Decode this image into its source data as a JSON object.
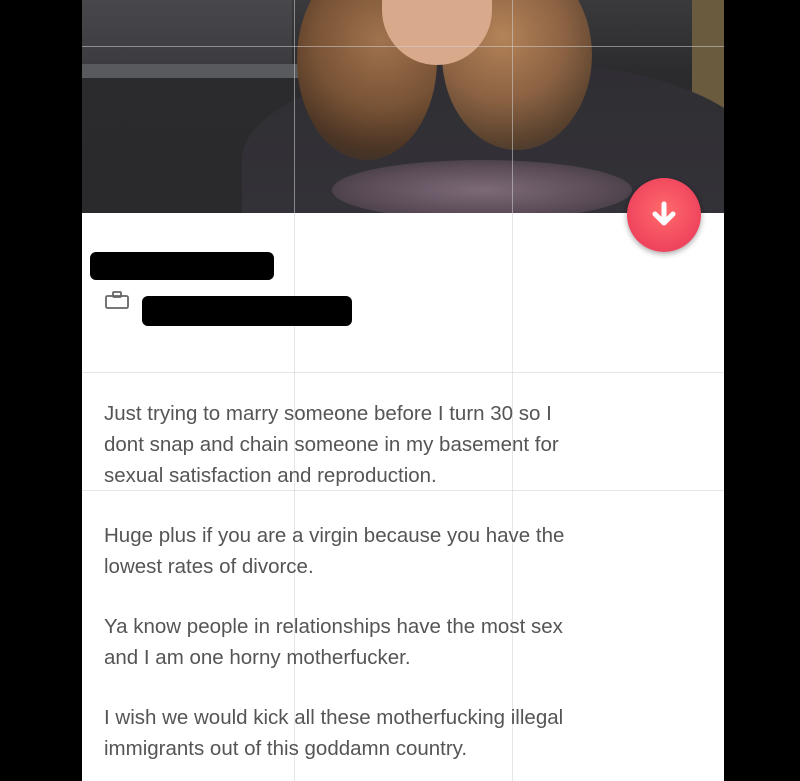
{
  "profile": {
    "name_redacted": true,
    "job_redacted": true,
    "action": {
      "icon": "arrow-down-icon",
      "color": "#f0465e"
    },
    "job_icon": "briefcase-icon",
    "bio": [
      "Just trying to marry someone before I turn 30 so I\ndont snap and chain someone in my basement for\nsexual satisfaction and reproduction.",
      "Huge plus if you are a virgin because you have the\nlowest rates of divorce.",
      "Ya know people in relationships have the most sex\nand I am one horny motherfucker.",
      "I wish we would kick all these motherfucking illegal\nimmigrants out of this goddamn country."
    ]
  }
}
